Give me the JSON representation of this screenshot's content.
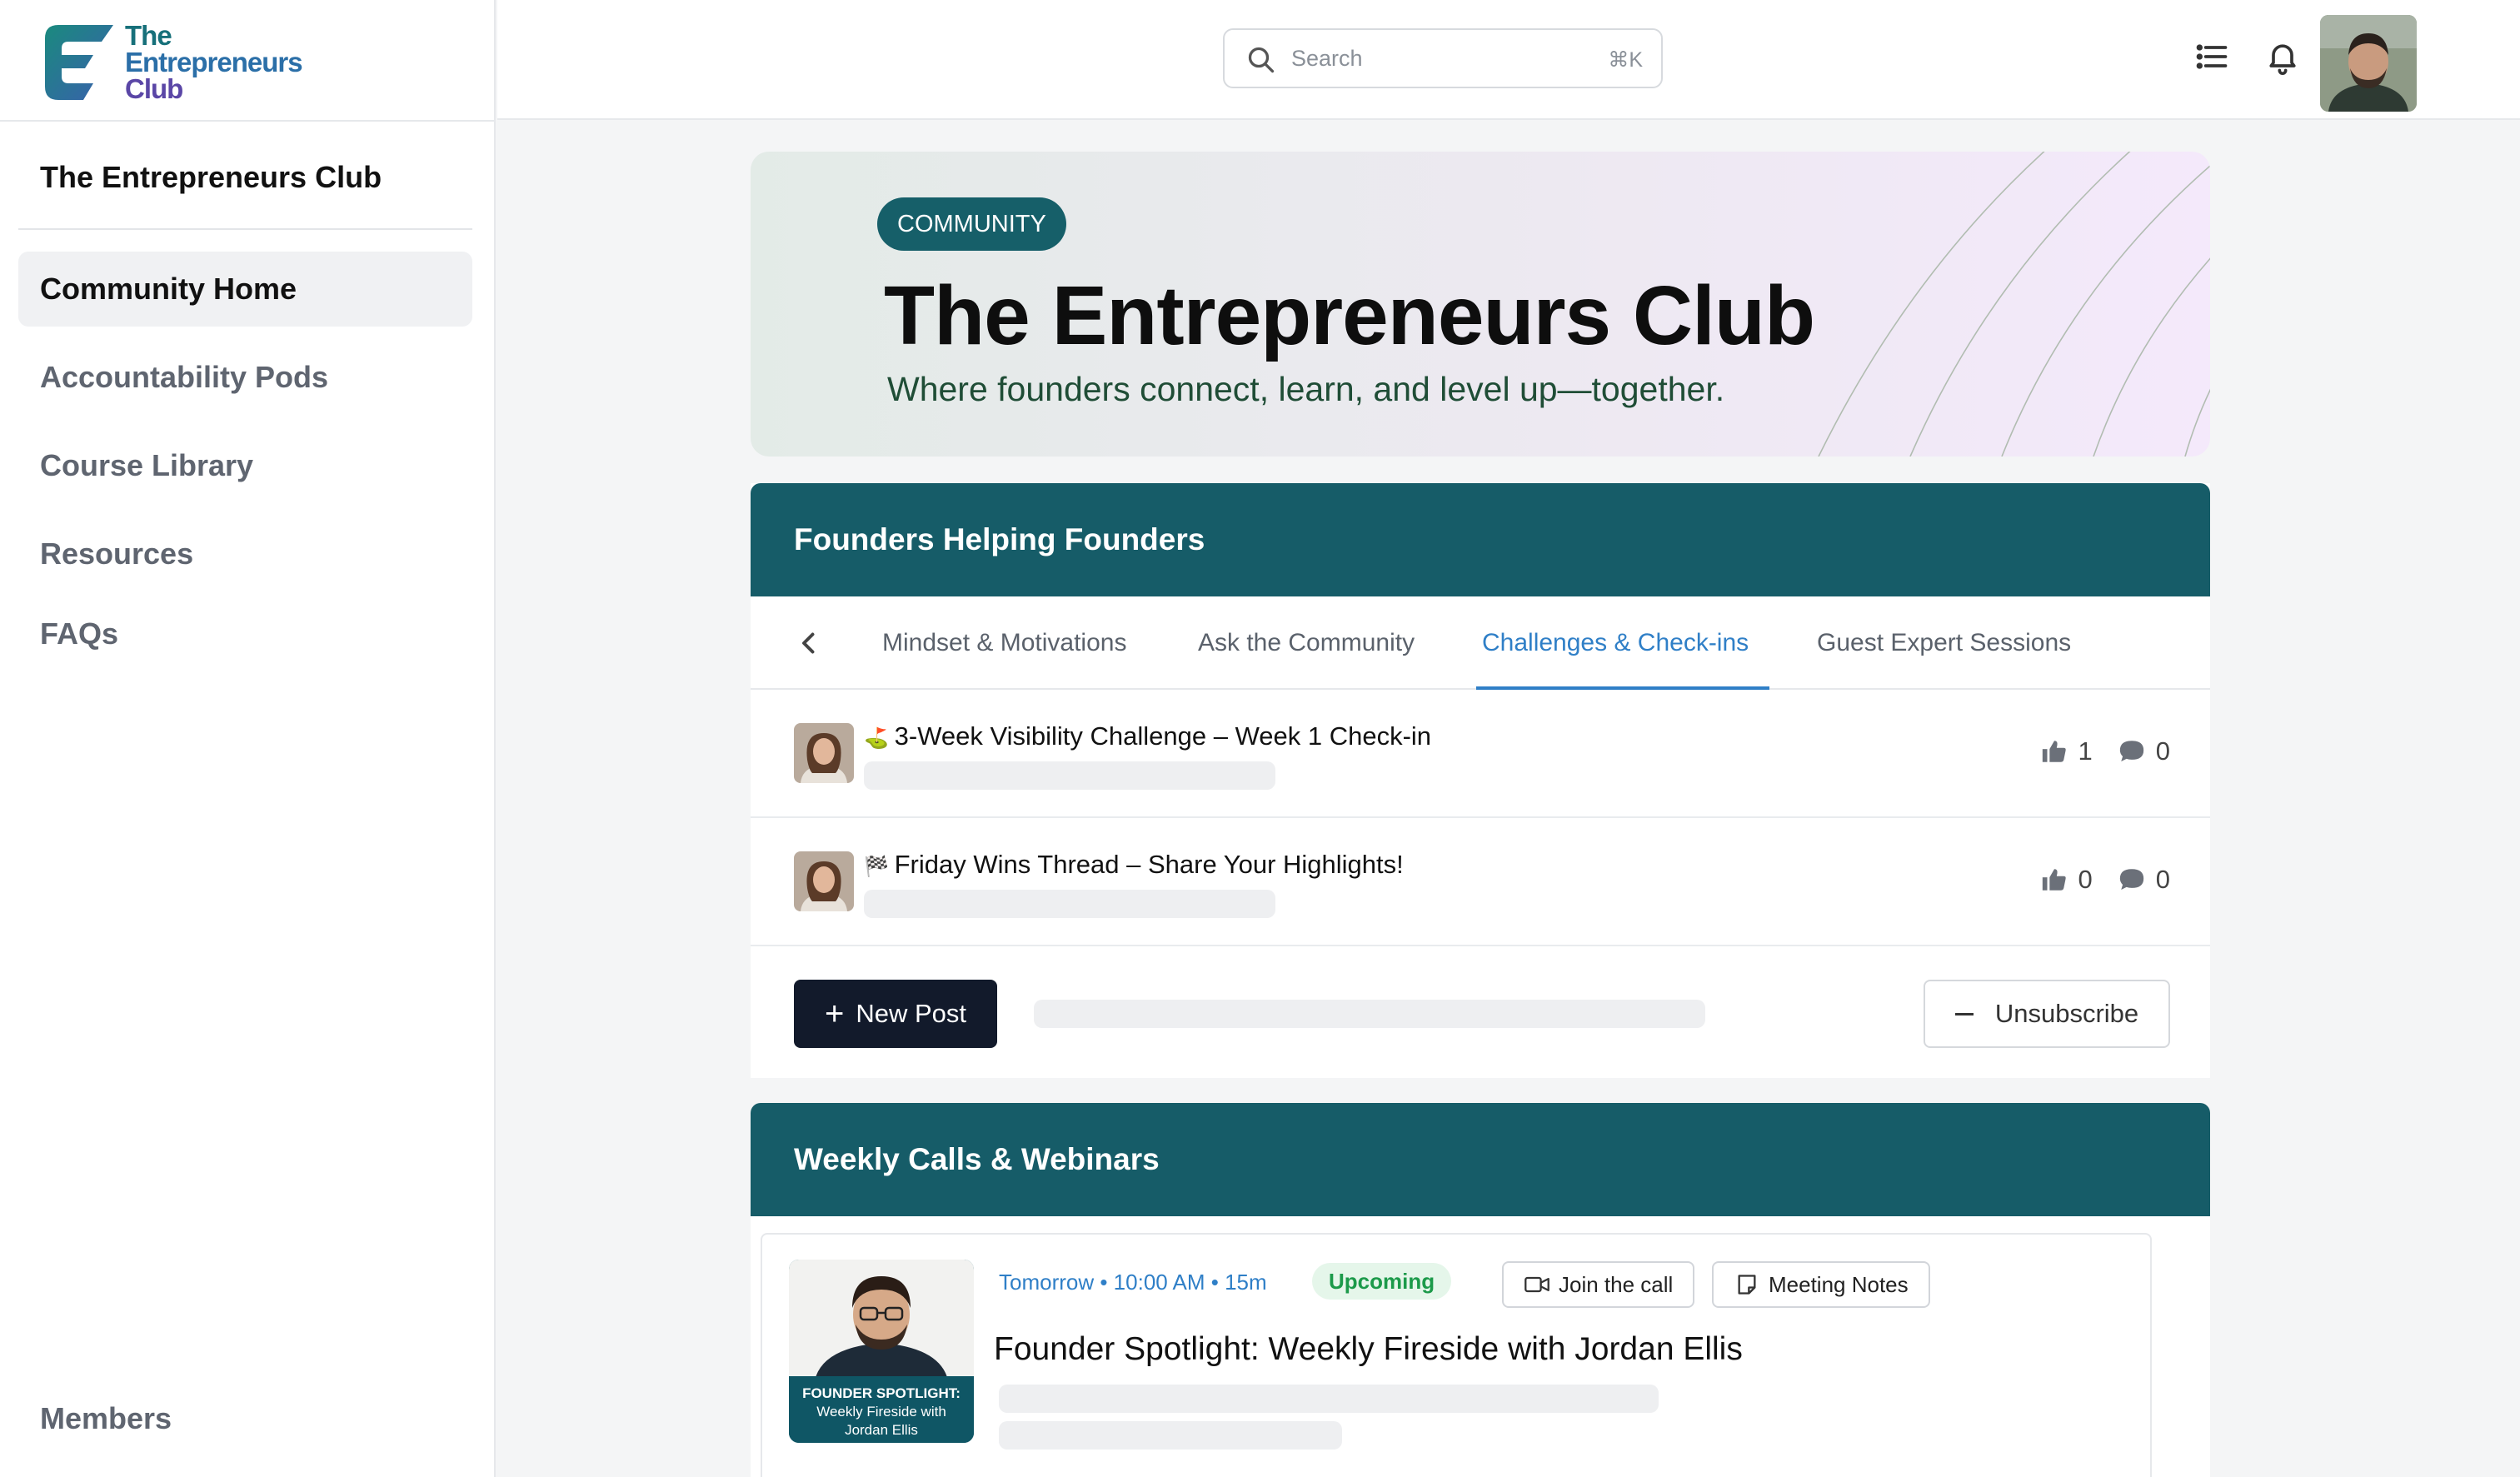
{
  "brand": {
    "logo_lines": [
      "The",
      "Entrepreneurs",
      "Club"
    ],
    "sidebar_title": "The Entrepreneurs Club"
  },
  "sidebar": {
    "items": [
      {
        "label": "Community Home"
      },
      {
        "label": "Accountability Pods"
      },
      {
        "label": "Course Library"
      },
      {
        "label": "Resources"
      },
      {
        "label": "FAQs"
      }
    ],
    "active_item": "Community Home",
    "footer_label": "Members"
  },
  "topbar": {
    "search_placeholder": "Search",
    "search_shortcut": "⌘K",
    "icons": [
      "search-icon",
      "list-icon",
      "bell-icon"
    ]
  },
  "hero": {
    "badge": "COMMUNITY",
    "title": "The Entrepreneurs Club",
    "subtitle": "Where founders connect, learn, and level up—together."
  },
  "forum": {
    "heading": "Founders Helping Founders",
    "tabs": [
      "Mindset & Motivations",
      "Ask the Community",
      "Challenges & Check-ins",
      "Guest Expert Sessions"
    ],
    "active_tab": "Challenges & Check-ins",
    "posts": [
      {
        "emoji": "⛳",
        "title": "3-Week Visibility Challenge – Week 1 Check-in",
        "likes": "1",
        "comments": "0"
      },
      {
        "emoji": "🏁",
        "title": "Friday Wins Thread – Share Your Highlights!",
        "likes": "0",
        "comments": "0"
      }
    ],
    "new_post_label": "New Post",
    "unsubscribe_label": "Unsubscribe"
  },
  "calls": {
    "heading": "Weekly Calls & Webinars",
    "items": [
      {
        "thumb_caption_1": "FOUNDER SPOTLIGHT:",
        "thumb_caption_2": "Weekly Fireside with",
        "thumb_caption_3": "Jordan Ellis",
        "meta": "Tomorrow • 10:00 AM • 15m",
        "status": "Upcoming",
        "join_label": "Join the call",
        "notes_label": "Meeting Notes",
        "title": "Founder Spotlight: Weekly Fireside with Jordan Ellis"
      }
    ]
  },
  "colors": {
    "brand_teal": "#165c68",
    "accent_blue": "#2f7fc7",
    "dark_button": "#121a2b",
    "upcoming_green": "#1c9a4a"
  }
}
